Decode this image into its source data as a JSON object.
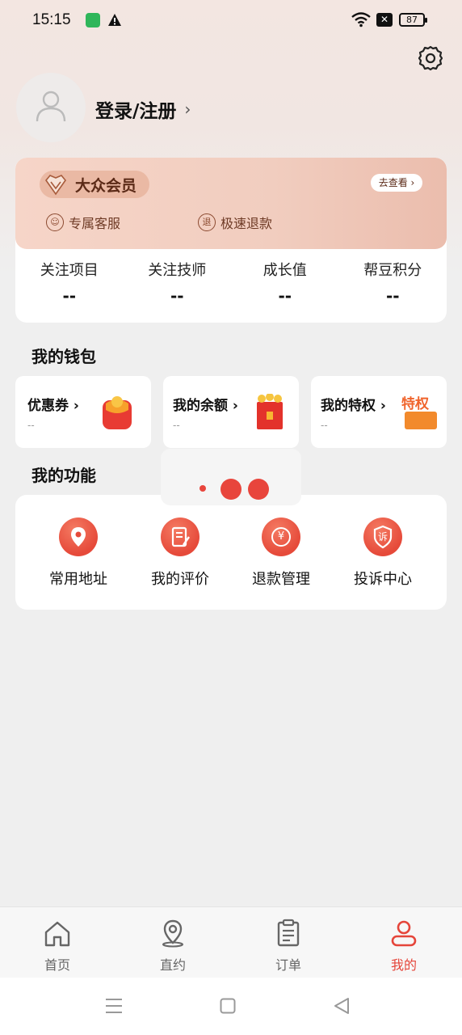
{
  "status_bar": {
    "time": "15:15",
    "battery": "87",
    "icons": [
      "app-notification-icon",
      "warning-icon",
      "wifi-icon",
      "close-notification-icon",
      "battery-icon"
    ]
  },
  "header": {
    "login_label": "登录/注册",
    "chevron": "›",
    "settings_icon": "gear-icon"
  },
  "member": {
    "tier": "大众会员",
    "go_see": "去查看 ›",
    "perks": [
      {
        "label": "专属客服",
        "icon": "service-icon"
      },
      {
        "label": "极速退款",
        "icon": "refund-icon",
        "badge": "退"
      }
    ],
    "stats": [
      {
        "label": "关注项目",
        "value": "--"
      },
      {
        "label": "关注技师",
        "value": "--"
      },
      {
        "label": "成长值",
        "value": "--"
      },
      {
        "label": "帮豆积分",
        "value": "--"
      }
    ]
  },
  "wallet": {
    "title": "我的钱包",
    "cards": [
      {
        "label": "优惠券 ›",
        "sub": "--"
      },
      {
        "label": "我的余额 ›",
        "sub": "--"
      },
      {
        "label": "我的特权 ›",
        "sub": "--",
        "art_text": "特权"
      }
    ]
  },
  "functions": {
    "title": "我的功能",
    "items": [
      {
        "label": "常用地址",
        "icon": "location-icon"
      },
      {
        "label": "我的评价",
        "icon": "review-icon"
      },
      {
        "label": "退款管理",
        "icon": "refund-yuan-icon",
        "glyph": "¥"
      },
      {
        "label": "投诉中心",
        "icon": "complaint-icon",
        "glyph": "诉"
      }
    ]
  },
  "tabbar": {
    "tabs": [
      {
        "label": "首页",
        "icon": "home-icon",
        "active": false
      },
      {
        "label": "直约",
        "icon": "location-pin-icon",
        "active": false
      },
      {
        "label": "订单",
        "icon": "order-icon",
        "active": false
      },
      {
        "label": "我的",
        "icon": "profile-icon",
        "active": true
      }
    ]
  },
  "colors": {
    "accent": "#e5453a",
    "member_bg": "#f1cdbf",
    "member_text": "#5b2a17"
  }
}
